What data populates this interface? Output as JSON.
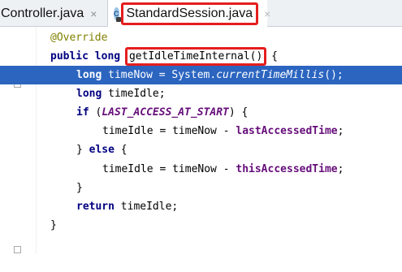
{
  "tabs": [
    {
      "label": "Controller.java",
      "close": "×"
    },
    {
      "icon_letter": "C",
      "label": "StandardSession.java",
      "close": "×"
    }
  ],
  "code": {
    "lines": [
      {
        "t": "annotation",
        "text": "@Override"
      },
      {
        "t": "sig",
        "kw1": "public",
        "kw2": "long",
        "method": "getIdleTimeInternal()",
        "rest": " {"
      },
      {
        "t": "decl",
        "kw": "long",
        "pre": " timeNow = System.",
        "call": "currentTimeMillis",
        "post": "();"
      },
      {
        "t": "simple",
        "kw": "long",
        "rest": " timeIdle;"
      },
      {
        "t": "if",
        "kw": "if",
        "pre": " (",
        "const": "LAST_ACCESS_AT_START",
        "post": ") {"
      },
      {
        "t": "assign",
        "pre": "timeIdle = timeNow - ",
        "field": "lastAccessedTime",
        "post": ";"
      },
      {
        "t": "else",
        "pre": "} ",
        "kw": "else",
        "post": " {"
      },
      {
        "t": "assign",
        "pre": "timeIdle = timeNow - ",
        "field": "thisAccessedTime",
        "post": ";"
      },
      {
        "t": "brace",
        "text": "}"
      },
      {
        "t": "return",
        "kw": "return",
        "rest": " timeIdle;"
      },
      {
        "t": "brace",
        "text": "}"
      }
    ]
  }
}
